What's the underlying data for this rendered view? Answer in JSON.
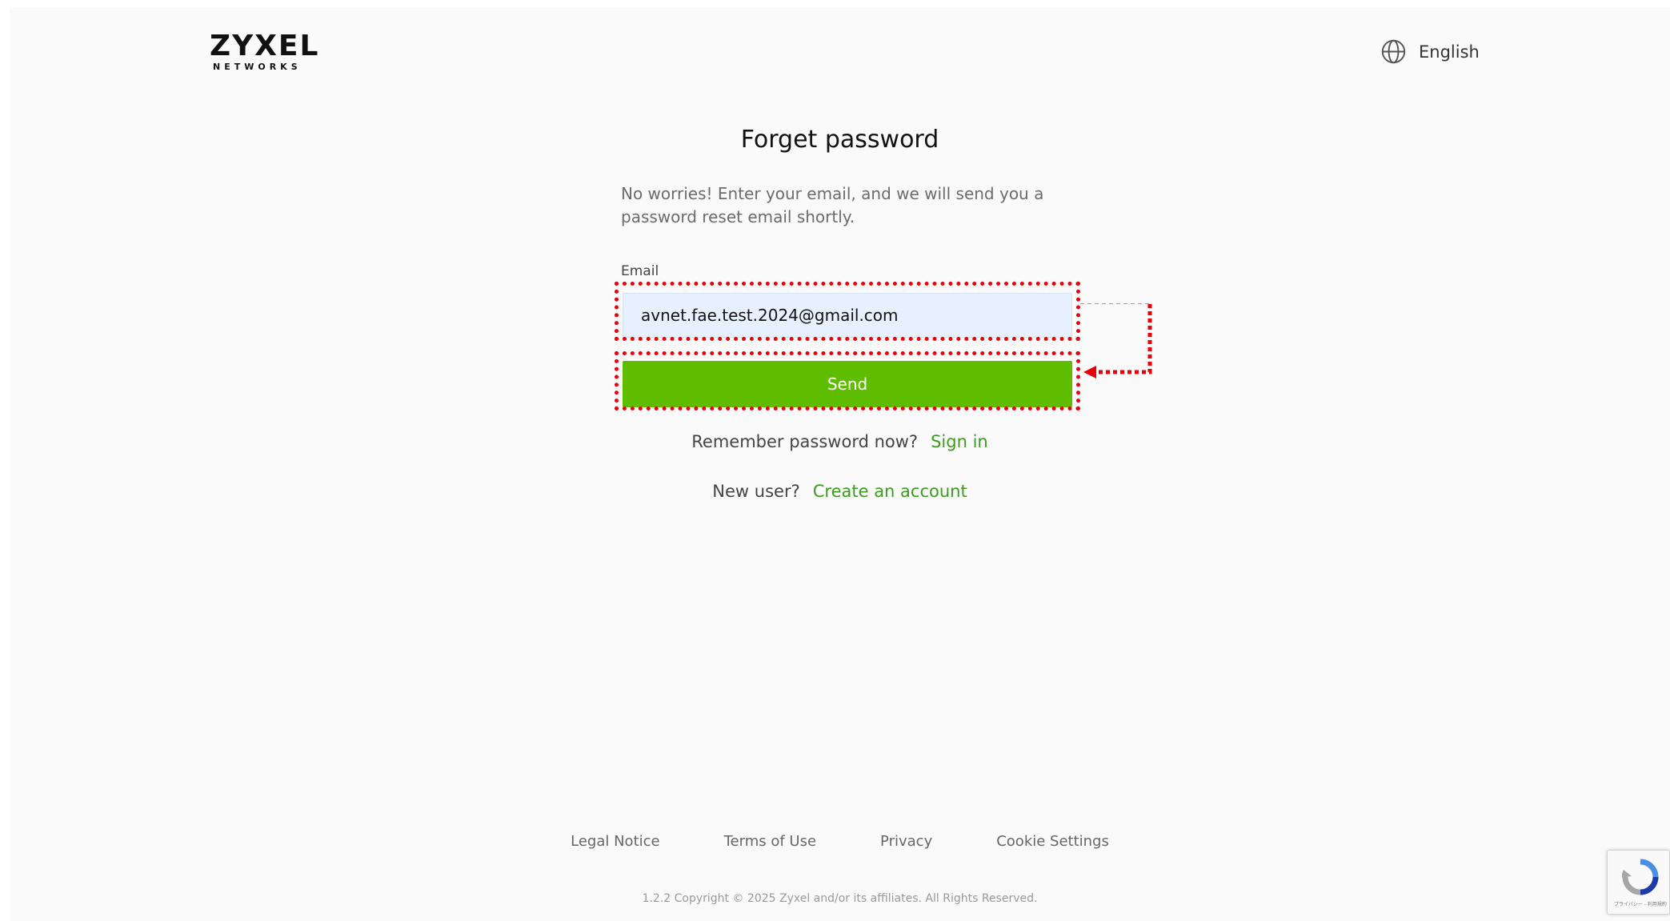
{
  "header": {
    "logo_main": "ZYXEL",
    "logo_sub": "NETWORKS",
    "language_label": "English"
  },
  "form": {
    "title": "Forget password",
    "description": "No worries! Enter your email, and we will send you a password reset email shortly.",
    "email_label": "Email",
    "email_value": "avnet.fae.test.2024@gmail.com",
    "send_label": "Send"
  },
  "links": {
    "remember_text": "Remember password now?",
    "sign_in_label": "Sign in",
    "new_user_text": "New user?",
    "create_account_label": "Create an account"
  },
  "footer": {
    "links": [
      "Legal Notice",
      "Terms of Use",
      "Privacy",
      "Cookie Settings"
    ],
    "copyright": "1.2.2 Copyright © 2025 Zyxel and/or its affiliates. All Rights Reserved."
  },
  "recaptcha": {
    "text": "プライバシー - 利用規約"
  },
  "colors": {
    "accent_green": "#5fbd00",
    "link_green": "#3c9c1f",
    "annotation_red": "#e8000b",
    "input_bg": "#e7f0fe"
  },
  "icons": {
    "language": "globe-icon",
    "recaptcha": "recaptcha-icon"
  }
}
